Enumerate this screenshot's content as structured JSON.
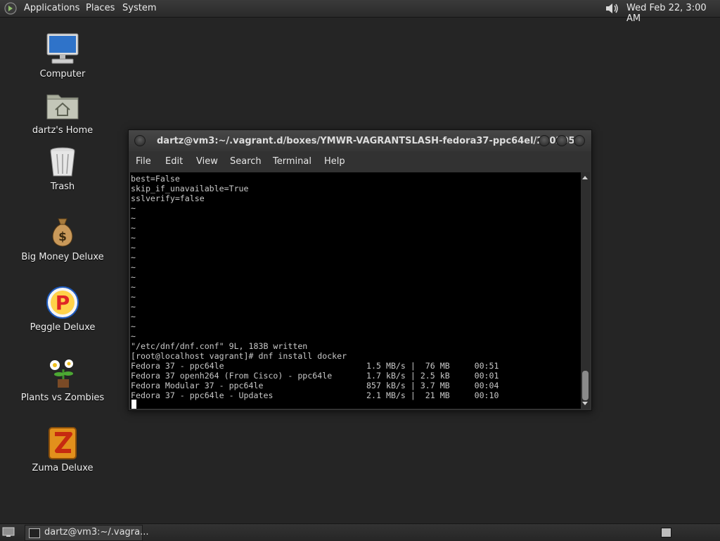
{
  "top_panel": {
    "menus": [
      "Applications",
      "Places",
      "System"
    ],
    "clock": "Wed Feb 22,  3:00 AM"
  },
  "desktop": {
    "icons": [
      {
        "label": "Computer",
        "icon": "computer-icon"
      },
      {
        "label": "dartz's Home",
        "icon": "home-folder-icon"
      },
      {
        "label": "Trash",
        "icon": "trash-icon"
      },
      {
        "label": "Big Money Deluxe",
        "icon": "money-bag-icon"
      },
      {
        "label": "Peggle Deluxe",
        "icon": "peggle-icon"
      },
      {
        "label": "Plants vs Zombies",
        "icon": "plants-icon"
      },
      {
        "label": "Zuma Deluxe",
        "icon": "zuma-icon"
      }
    ]
  },
  "terminal": {
    "title": "dartz@vm3:~/.vagrant.d/boxes/YMWR-VAGRANTSLASH-fedora37-ppc64el/230205...",
    "menu": [
      "File",
      "Edit",
      "View",
      "Search",
      "Terminal",
      "Help"
    ],
    "lines": [
      "best=False",
      "skip_if_unavailable=True",
      "sslverify=false",
      "~",
      "~",
      "~",
      "~",
      "~",
      "~",
      "~",
      "~",
      "~",
      "~",
      "~",
      "~",
      "~",
      "~",
      "\"/etc/dnf/dnf.conf\" 9L, 183B written",
      "[root@localhost vagrant]# dnf install docker",
      "Fedora 37 - ppc64le                             1.5 MB/s |  76 MB     00:51",
      "Fedora 37 openh264 (From Cisco) - ppc64le       1.7 kB/s | 2.5 kB     00:01",
      "Fedora Modular 37 - ppc64le                     857 kB/s | 3.7 MB     00:04",
      "Fedora 37 - ppc64le - Updates                   2.1 MB/s |  21 MB     00:10"
    ]
  },
  "taskbar": {
    "task_label": "dartz@vm3:~/.vagra..."
  }
}
